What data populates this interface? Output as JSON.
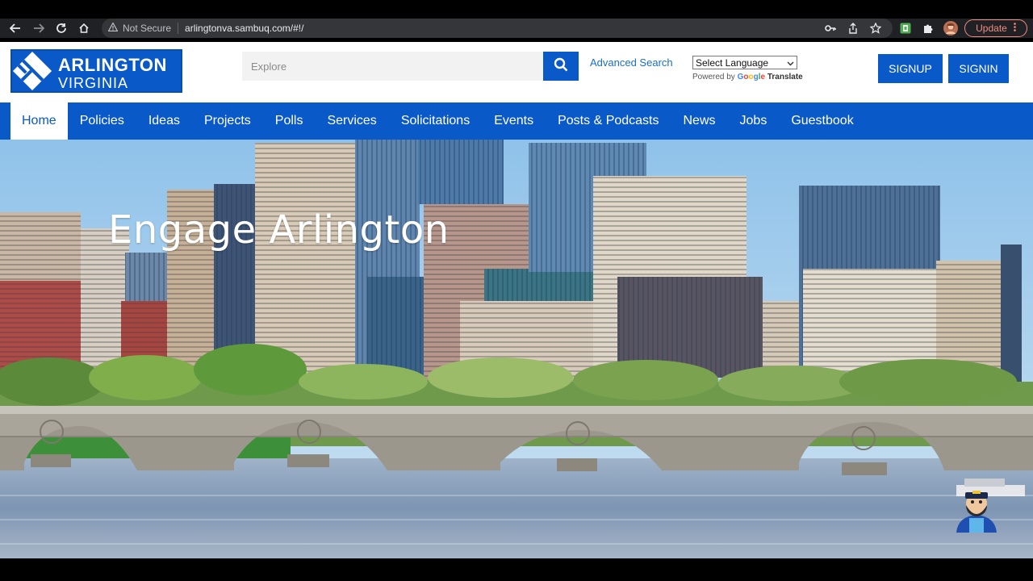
{
  "browser": {
    "security_label": "Not Secure",
    "url": "arlingtonva.sambuq.com/#!/",
    "update_label": "Update"
  },
  "header": {
    "logo_line1": "ARLINGTON",
    "logo_line2": "VIRGINIA",
    "search_placeholder": "Explore",
    "advanced_search": "Advanced Search",
    "language_select": "Select Language",
    "powered_by": "Powered by",
    "google": "Google",
    "translate": "Translate",
    "signup": "SIGNUP",
    "signin": "SIGNIN"
  },
  "nav": {
    "items": [
      "Home",
      "Policies",
      "Ideas",
      "Projects",
      "Polls",
      "Services",
      "Solicitations",
      "Events",
      "Posts & Podcasts",
      "News",
      "Jobs",
      "Guestbook"
    ],
    "active": "Home"
  },
  "hero": {
    "title": "Engage Arlington"
  },
  "colors": {
    "brand_blue": "#0a59c8",
    "chrome_bg": "#202124"
  },
  "icons": [
    "back-arrow-icon",
    "forward-arrow-icon",
    "reload-icon",
    "home-icon",
    "warning-icon",
    "key-icon",
    "share-icon",
    "star-icon",
    "extension-icon",
    "puzzle-icon",
    "profile-avatar-icon",
    "more-icon",
    "search-icon",
    "chevron-down-icon",
    "mascot-icon"
  ]
}
